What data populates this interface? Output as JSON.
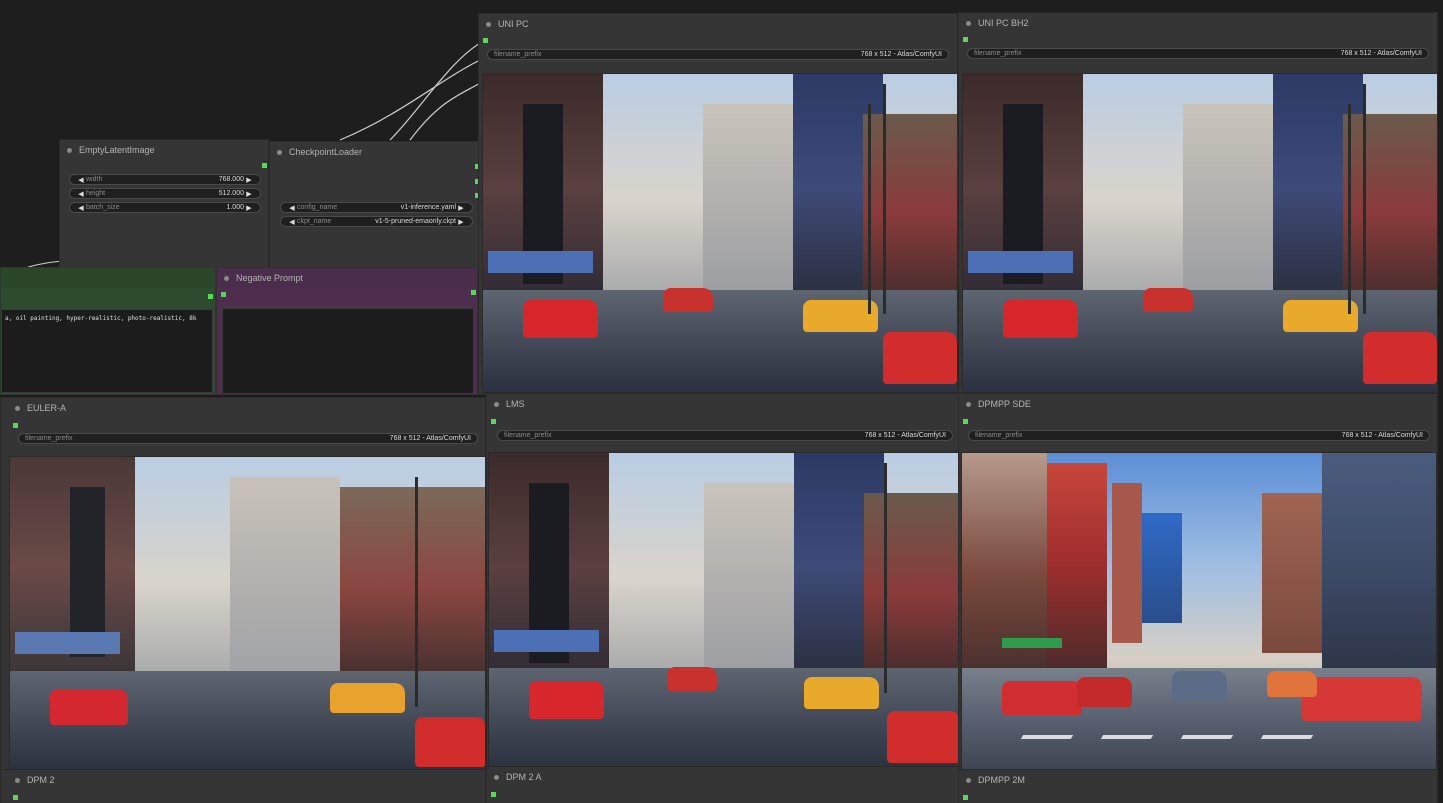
{
  "nodes": {
    "empty_latent": {
      "title": "EmptyLatentImage",
      "widgets": [
        {
          "name": "width",
          "value": "768.000"
        },
        {
          "name": "height",
          "value": "512.000"
        },
        {
          "name": "batch_size",
          "value": "1.000"
        }
      ]
    },
    "checkpoint": {
      "title": "CheckpointLoader",
      "widgets": [
        {
          "name": "config_name",
          "value": "v1-inference.yaml"
        },
        {
          "name": "ckpt_name",
          "value": "v1-5-pruned-emaonly.ckpt"
        }
      ]
    },
    "positive": {
      "text": "a, oil painting, hyper-realistic, photo-realistic, 8k"
    },
    "negative": {
      "title": "Negative Prompt"
    }
  },
  "previews": {
    "uni_pc": {
      "title": "UNI PC",
      "widget_name": "filename_prefix",
      "widget_value": "768 x 512 - Atlas/ComfyUI"
    },
    "uni_pc_bh2": {
      "title": "UNI PC BH2",
      "widget_name": "filename_prefix",
      "widget_value": "768 x 512 - Atlas/ComfyUI"
    },
    "euler_a": {
      "title": "EULER-A",
      "widget_name": "filename_prefix",
      "widget_value": "768 x 512 - Atlas/ComfyUI"
    },
    "lms": {
      "title": "LMS",
      "widget_name": "filename_prefix",
      "widget_value": "768 x 512 - Atlas/ComfyUI"
    },
    "dpmpp_sde": {
      "title": "DPMPP SDE",
      "widget_name": "filename_prefix",
      "widget_value": "768 x 512 - Atlas/ComfyUI"
    },
    "dpm2": {
      "title": "DPM 2"
    },
    "dpm2a": {
      "title": "DPM 2 A"
    },
    "dpmpp_2m": {
      "title": "DPMPP 2M"
    }
  },
  "colors": {
    "canvas": "#1e1e1e",
    "node": "#353535",
    "slot": "#58d858",
    "positive_node": "#2f4b2f",
    "negative_node": "#4d2e4d",
    "wire": "#cfcfcf"
  }
}
